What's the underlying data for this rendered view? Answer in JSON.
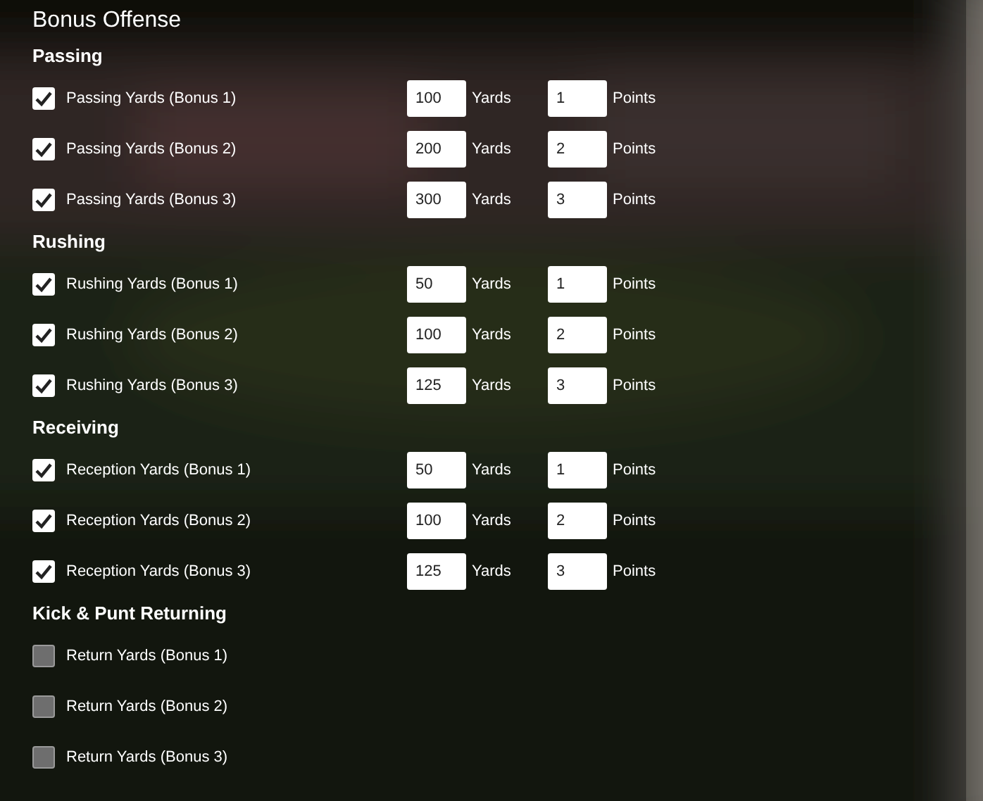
{
  "title": "Bonus Offense",
  "sections": [
    {
      "heading": "Passing",
      "rows": [
        {
          "label": "Passing Yards (Bonus 1)",
          "checked": true,
          "yards": "100",
          "yards_unit": "Yards",
          "points": "1",
          "points_unit": "Points"
        },
        {
          "label": "Passing Yards (Bonus 2)",
          "checked": true,
          "yards": "200",
          "yards_unit": "Yards",
          "points": "2",
          "points_unit": "Points"
        },
        {
          "label": "Passing Yards (Bonus 3)",
          "checked": true,
          "yards": "300",
          "yards_unit": "Yards",
          "points": "3",
          "points_unit": "Points"
        }
      ]
    },
    {
      "heading": "Rushing",
      "rows": [
        {
          "label": "Rushing Yards (Bonus 1)",
          "checked": true,
          "yards": "50",
          "yards_unit": "Yards",
          "points": "1",
          "points_unit": "Points"
        },
        {
          "label": "Rushing Yards (Bonus 2)",
          "checked": true,
          "yards": "100",
          "yards_unit": "Yards",
          "points": "2",
          "points_unit": "Points"
        },
        {
          "label": "Rushing Yards (Bonus 3)",
          "checked": true,
          "yards": "125",
          "yards_unit": "Yards",
          "points": "3",
          "points_unit": "Points"
        }
      ]
    },
    {
      "heading": "Receiving",
      "rows": [
        {
          "label": "Reception Yards (Bonus 1)",
          "checked": true,
          "yards": "50",
          "yards_unit": "Yards",
          "points": "1",
          "points_unit": "Points"
        },
        {
          "label": "Reception Yards (Bonus 2)",
          "checked": true,
          "yards": "100",
          "yards_unit": "Yards",
          "points": "2",
          "points_unit": "Points"
        },
        {
          "label": "Reception Yards (Bonus 3)",
          "checked": true,
          "yards": "125",
          "yards_unit": "Yards",
          "points": "3",
          "points_unit": "Points"
        }
      ]
    },
    {
      "heading": "Kick & Punt Returning",
      "rows": [
        {
          "label": "Return Yards (Bonus 1)",
          "checked": false
        },
        {
          "label": "Return Yards (Bonus 2)",
          "checked": false
        },
        {
          "label": "Return Yards (Bonus 3)",
          "checked": false
        }
      ]
    }
  ]
}
